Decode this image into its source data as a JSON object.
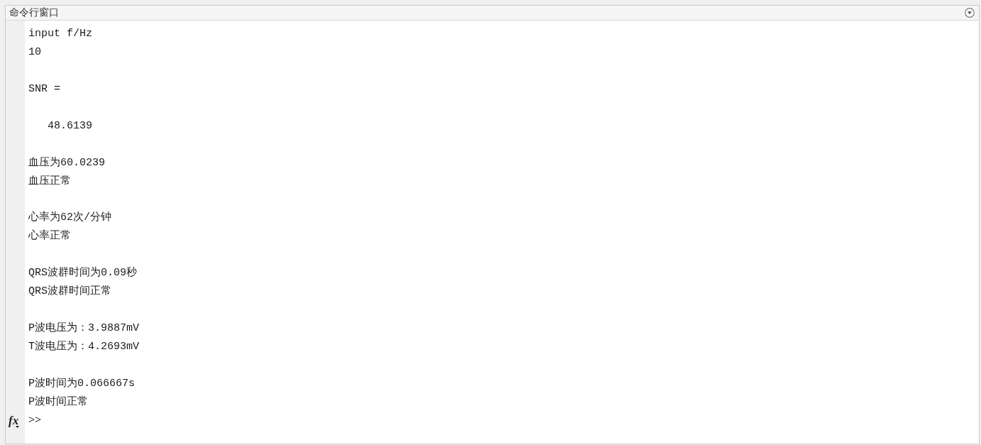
{
  "window": {
    "title": "命令行窗口"
  },
  "output": [
    {
      "kind": "text",
      "lines": [
        "input f/Hz",
        "10"
      ]
    },
    {
      "kind": "variable",
      "name": "SNR =",
      "value": "48.6139"
    },
    {
      "kind": "text",
      "lines": [
        "血压为60.0239",
        "血压正常"
      ]
    },
    {
      "kind": "text",
      "lines": [
        "心率为62次/分钟",
        "心率正常"
      ]
    },
    {
      "kind": "text",
      "lines": [
        "QRS波群时间为0.09秒",
        "QRS波群时间正常"
      ]
    },
    {
      "kind": "text",
      "lines": [
        "P波电压为：3.9887mV",
        "T波电压为：4.2693mV"
      ]
    },
    {
      "kind": "text",
      "lines": [
        "P波时间为0.066667s",
        "P波时间正常"
      ]
    }
  ],
  "prompt": {
    "button": "fx",
    "symbol": ">>"
  }
}
